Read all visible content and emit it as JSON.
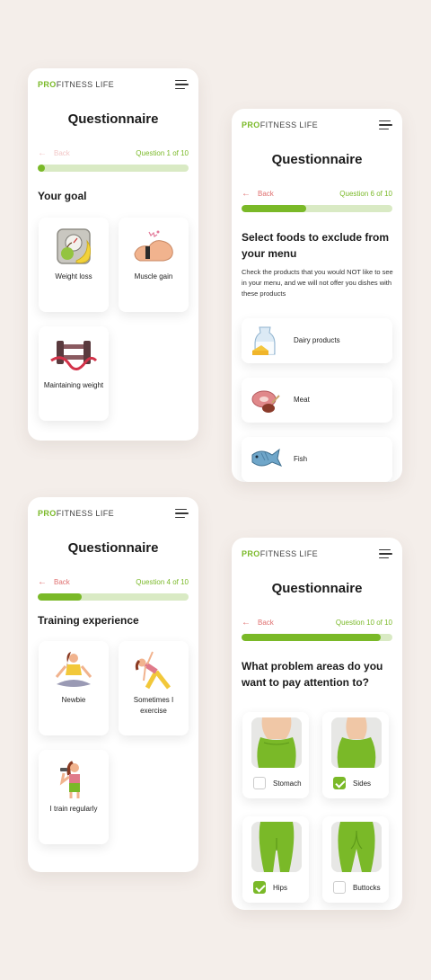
{
  "brand": {
    "pro": "PRO",
    "rest": "FITNESS LIFE"
  },
  "colors": {
    "accent": "#7ab928",
    "accent_light": "#d9eac4",
    "back": "#e07070",
    "background": "#f4eeea"
  },
  "screens": {
    "goal": {
      "title": "Questionnaire",
      "back": "Back",
      "question": "Question 1 of 10",
      "progress": 0.03,
      "heading": "Your goal",
      "options": [
        {
          "label": "Weight loss",
          "icon": "scale-apple-icon"
        },
        {
          "label": "Muscle gain",
          "icon": "flexed-arm-icon"
        },
        {
          "label": "Maintaining weight",
          "icon": "dumbbells-tape-icon"
        }
      ]
    },
    "foods": {
      "title": "Questionnaire",
      "back": "Back",
      "question": "Question 6 of 10",
      "progress": 0.43,
      "heading": "Select foods to exclude from your menu",
      "description": "Check the products that you would NOT like to see in your menu, and we will not offer you dishes with these products",
      "items": [
        {
          "label": "Dairy products",
          "icon": "milk-cheese-icon"
        },
        {
          "label": "Meat",
          "icon": "steak-icon"
        },
        {
          "label": "Fish",
          "icon": "fish-icon"
        }
      ]
    },
    "experience": {
      "title": "Questionnaire",
      "back": "Back",
      "question": "Question 4 of 10",
      "progress": 0.29,
      "heading": "Training experience",
      "options": [
        {
          "label": "Newbie",
          "icon": "yoga-woman-icon"
        },
        {
          "label": "Sometimes I exercise",
          "icon": "stretching-woman-icon"
        },
        {
          "label": "I train regularly",
          "icon": "dumbbell-woman-icon"
        }
      ]
    },
    "areas": {
      "title": "Questionnaire",
      "back": "Back",
      "question": "Question 10 of 10",
      "progress": 0.92,
      "heading": "What problem areas do you want to pay attention to?",
      "items": [
        {
          "label": "Stomach",
          "checked": false,
          "icon": "stomach-photo"
        },
        {
          "label": "Sides",
          "checked": true,
          "icon": "sides-photo"
        },
        {
          "label": "Hips",
          "checked": true,
          "icon": "hips-photo"
        },
        {
          "label": "Buttocks",
          "checked": false,
          "icon": "buttocks-photo"
        }
      ]
    }
  }
}
